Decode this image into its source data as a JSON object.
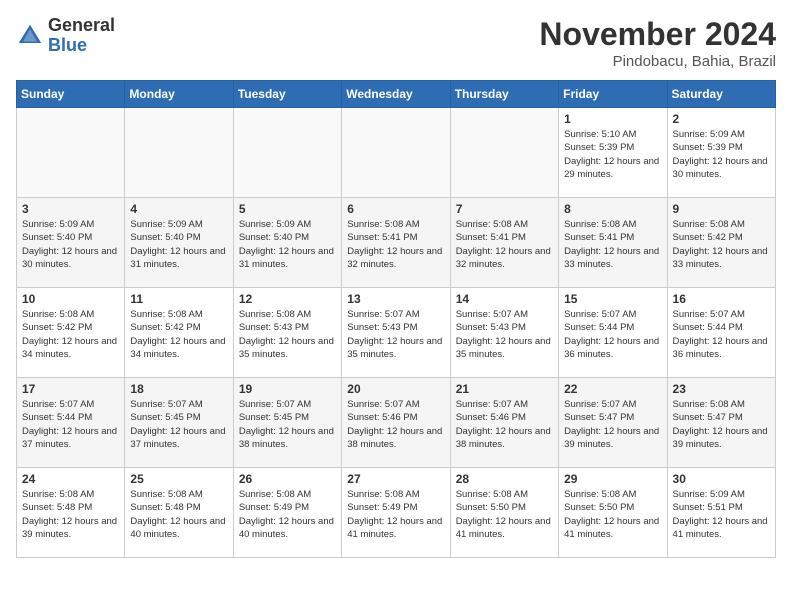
{
  "header": {
    "logo_general": "General",
    "logo_blue": "Blue",
    "month_year": "November 2024",
    "location": "Pindobacu, Bahia, Brazil"
  },
  "days_of_week": [
    "Sunday",
    "Monday",
    "Tuesday",
    "Wednesday",
    "Thursday",
    "Friday",
    "Saturday"
  ],
  "weeks": [
    [
      {
        "day": "",
        "info": ""
      },
      {
        "day": "",
        "info": ""
      },
      {
        "day": "",
        "info": ""
      },
      {
        "day": "",
        "info": ""
      },
      {
        "day": "",
        "info": ""
      },
      {
        "day": "1",
        "info": "Sunrise: 5:10 AM\nSunset: 5:39 PM\nDaylight: 12 hours and 29 minutes."
      },
      {
        "day": "2",
        "info": "Sunrise: 5:09 AM\nSunset: 5:39 PM\nDaylight: 12 hours and 30 minutes."
      }
    ],
    [
      {
        "day": "3",
        "info": "Sunrise: 5:09 AM\nSunset: 5:40 PM\nDaylight: 12 hours and 30 minutes."
      },
      {
        "day": "4",
        "info": "Sunrise: 5:09 AM\nSunset: 5:40 PM\nDaylight: 12 hours and 31 minutes."
      },
      {
        "day": "5",
        "info": "Sunrise: 5:09 AM\nSunset: 5:40 PM\nDaylight: 12 hours and 31 minutes."
      },
      {
        "day": "6",
        "info": "Sunrise: 5:08 AM\nSunset: 5:41 PM\nDaylight: 12 hours and 32 minutes."
      },
      {
        "day": "7",
        "info": "Sunrise: 5:08 AM\nSunset: 5:41 PM\nDaylight: 12 hours and 32 minutes."
      },
      {
        "day": "8",
        "info": "Sunrise: 5:08 AM\nSunset: 5:41 PM\nDaylight: 12 hours and 33 minutes."
      },
      {
        "day": "9",
        "info": "Sunrise: 5:08 AM\nSunset: 5:42 PM\nDaylight: 12 hours and 33 minutes."
      }
    ],
    [
      {
        "day": "10",
        "info": "Sunrise: 5:08 AM\nSunset: 5:42 PM\nDaylight: 12 hours and 34 minutes."
      },
      {
        "day": "11",
        "info": "Sunrise: 5:08 AM\nSunset: 5:42 PM\nDaylight: 12 hours and 34 minutes."
      },
      {
        "day": "12",
        "info": "Sunrise: 5:08 AM\nSunset: 5:43 PM\nDaylight: 12 hours and 35 minutes."
      },
      {
        "day": "13",
        "info": "Sunrise: 5:07 AM\nSunset: 5:43 PM\nDaylight: 12 hours and 35 minutes."
      },
      {
        "day": "14",
        "info": "Sunrise: 5:07 AM\nSunset: 5:43 PM\nDaylight: 12 hours and 35 minutes."
      },
      {
        "day": "15",
        "info": "Sunrise: 5:07 AM\nSunset: 5:44 PM\nDaylight: 12 hours and 36 minutes."
      },
      {
        "day": "16",
        "info": "Sunrise: 5:07 AM\nSunset: 5:44 PM\nDaylight: 12 hours and 36 minutes."
      }
    ],
    [
      {
        "day": "17",
        "info": "Sunrise: 5:07 AM\nSunset: 5:44 PM\nDaylight: 12 hours and 37 minutes."
      },
      {
        "day": "18",
        "info": "Sunrise: 5:07 AM\nSunset: 5:45 PM\nDaylight: 12 hours and 37 minutes."
      },
      {
        "day": "19",
        "info": "Sunrise: 5:07 AM\nSunset: 5:45 PM\nDaylight: 12 hours and 38 minutes."
      },
      {
        "day": "20",
        "info": "Sunrise: 5:07 AM\nSunset: 5:46 PM\nDaylight: 12 hours and 38 minutes."
      },
      {
        "day": "21",
        "info": "Sunrise: 5:07 AM\nSunset: 5:46 PM\nDaylight: 12 hours and 38 minutes."
      },
      {
        "day": "22",
        "info": "Sunrise: 5:07 AM\nSunset: 5:47 PM\nDaylight: 12 hours and 39 minutes."
      },
      {
        "day": "23",
        "info": "Sunrise: 5:08 AM\nSunset: 5:47 PM\nDaylight: 12 hours and 39 minutes."
      }
    ],
    [
      {
        "day": "24",
        "info": "Sunrise: 5:08 AM\nSunset: 5:48 PM\nDaylight: 12 hours and 39 minutes."
      },
      {
        "day": "25",
        "info": "Sunrise: 5:08 AM\nSunset: 5:48 PM\nDaylight: 12 hours and 40 minutes."
      },
      {
        "day": "26",
        "info": "Sunrise: 5:08 AM\nSunset: 5:49 PM\nDaylight: 12 hours and 40 minutes."
      },
      {
        "day": "27",
        "info": "Sunrise: 5:08 AM\nSunset: 5:49 PM\nDaylight: 12 hours and 41 minutes."
      },
      {
        "day": "28",
        "info": "Sunrise: 5:08 AM\nSunset: 5:50 PM\nDaylight: 12 hours and 41 minutes."
      },
      {
        "day": "29",
        "info": "Sunrise: 5:08 AM\nSunset: 5:50 PM\nDaylight: 12 hours and 41 minutes."
      },
      {
        "day": "30",
        "info": "Sunrise: 5:09 AM\nSunset: 5:51 PM\nDaylight: 12 hours and 41 minutes."
      }
    ]
  ]
}
